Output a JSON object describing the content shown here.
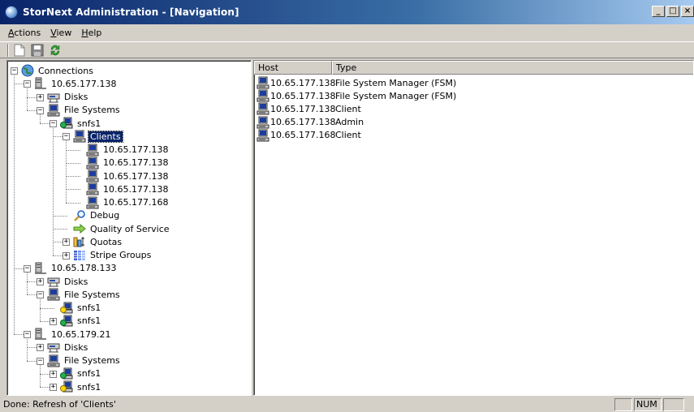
{
  "window": {
    "title": "StorNext Administration - [Navigation]",
    "buttons": [
      "_",
      "□",
      "×"
    ]
  },
  "menu": [
    {
      "label": "Actions",
      "accel": "A",
      "rest": "ctions"
    },
    {
      "label": "View",
      "accel": "V",
      "rest": "iew"
    },
    {
      "label": "Help",
      "accel": "H",
      "rest": "elp"
    }
  ],
  "toolbar": {
    "items": [
      "new-document-icon",
      "save-icon",
      "refresh-icon"
    ]
  },
  "tree": {
    "root_label": "Connections",
    "hosts": [
      {
        "label": "10.65.177.138",
        "disks_label": "Disks",
        "fs_label": "File Systems",
        "fs": [
          {
            "label": "snfs1",
            "clients_label": "Clients",
            "clients": [
              "10.65.177.138",
              "10.65.177.138",
              "10.65.177.138",
              "10.65.177.138",
              "10.65.177.168"
            ],
            "debug_label": "Debug",
            "qos_label": "Quality of Service",
            "quotas_label": "Quotas",
            "stripe_label": "Stripe Groups"
          }
        ]
      },
      {
        "label": "10.65.178.133",
        "disks_label": "Disks",
        "fs_label": "File Systems",
        "fs": [
          {
            "label": "snfs1"
          },
          {
            "label": "snfs1"
          }
        ]
      },
      {
        "label": "10.65.179.21",
        "disks_label": "Disks",
        "fs_label": "File Systems",
        "fs": [
          {
            "label": "snfs1"
          },
          {
            "label": "snfs1"
          }
        ]
      }
    ]
  },
  "list": {
    "columns": [
      "Host",
      "Type"
    ],
    "rows": [
      {
        "host": "10.65.177.138",
        "type": "File System Manager (FSM)"
      },
      {
        "host": "10.65.177.138",
        "type": "File System Manager (FSM)"
      },
      {
        "host": "10.65.177.138",
        "type": "Client"
      },
      {
        "host": "10.65.177.138",
        "type": "Admin"
      },
      {
        "host": "10.65.177.168",
        "type": "Client"
      }
    ]
  },
  "status": {
    "text": "Done: Refresh of 'Clients'",
    "num": "NUM"
  }
}
